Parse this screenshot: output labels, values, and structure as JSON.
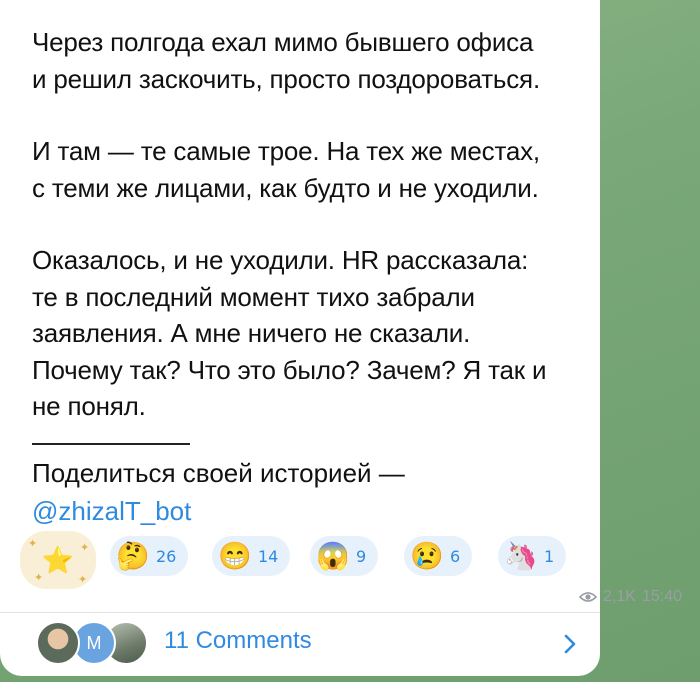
{
  "message": {
    "paragraphs": [
      "Через полгода ехал мимо бывшего офиса\nи решил заскочить, просто поздороваться.",
      "И там — те самые трое. На тех же местах,\nс теми же лицами, как будто и не уходили.",
      "Оказалось, и не уходили. HR рассказала:\nте в последний момент тихо забрали\nзаявления. А мне ничего не сказали.\nПочему так? Что это было? Зачем? Я так и\nне понял."
    ],
    "share_text": "Поделиться своей историей —",
    "bot_link": "@zhizalT_bot"
  },
  "reactions": [
    {
      "emoji": "🤔",
      "count": "26"
    },
    {
      "emoji": "😁",
      "count": "14"
    },
    {
      "emoji": "😱",
      "count": "9"
    },
    {
      "emoji": "😢",
      "count": "6"
    },
    {
      "emoji": "🦄",
      "count": "1"
    }
  ],
  "paid_star_emoji": "⭐",
  "meta": {
    "views": "2,1K",
    "time": "15:40"
  },
  "comments": {
    "label": "11 Comments",
    "avatar_letter": "M"
  },
  "colors": {
    "link": "#2f8ae0",
    "reaction_bg": "#e6f1fb",
    "star_bg": "#f9efd6"
  }
}
